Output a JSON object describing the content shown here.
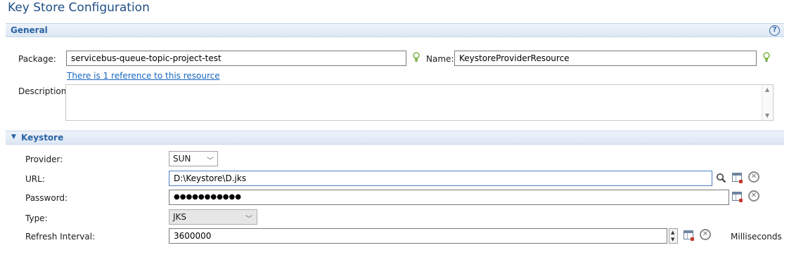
{
  "page": {
    "title": "Key Store Configuration"
  },
  "general": {
    "section_title": "General",
    "help_label": "?",
    "package_label": "Package:",
    "package_value": "servicebus-queue-topic-project-test",
    "name_label": "Name:",
    "name_value": "KeystoreProviderResource",
    "reference_link": "There is 1 reference to this resource",
    "description_label": "Description:",
    "description_value": ""
  },
  "keystore": {
    "section_title": "Keystore",
    "provider_label": "Provider:",
    "provider_value": "SUN",
    "url_label": "URL:",
    "url_value": "D:\\Keystore\\D.jks",
    "password_label": "Password:",
    "password_value": "●●●●●●●●●●●",
    "type_label": "Type:",
    "type_value": "JKS",
    "refresh_label": "Refresh Interval:",
    "refresh_value": "3600000",
    "refresh_unit": "Milliseconds"
  },
  "colors": {
    "title": "#1e4f86",
    "section_text": "#2a64a6",
    "link": "#1565c0",
    "bulb": "#8bc34a"
  },
  "icons": {
    "bulb": "lightbulb-icon",
    "search": "search-icon",
    "variable": "variable-table-icon",
    "clear": "clear-icon",
    "collapse": "triangle-down-icon"
  }
}
